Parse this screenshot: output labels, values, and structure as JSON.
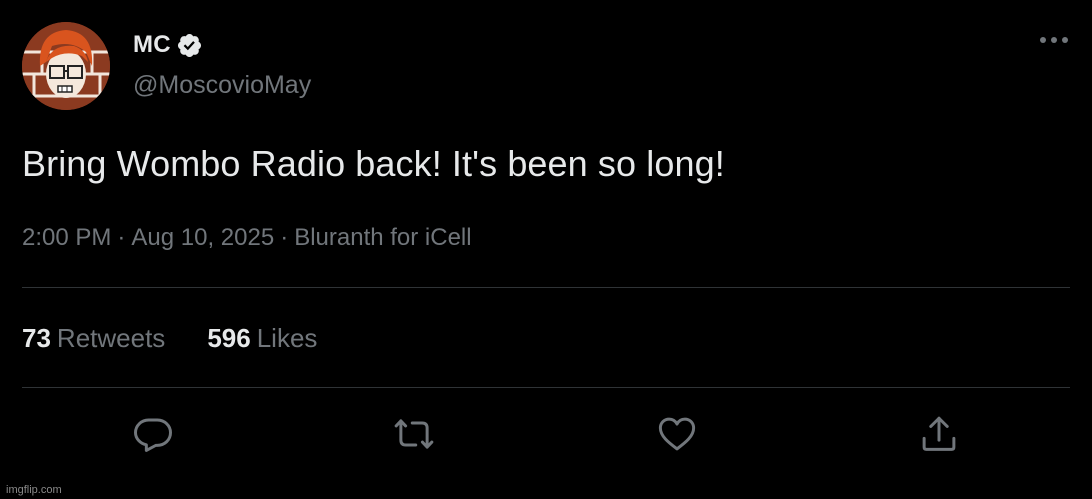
{
  "tweet": {
    "display_name": "MC",
    "handle": "@MoscovioMay",
    "text": "Bring Wombo Radio back! It's been so long!",
    "meta": {
      "time": "2:00 PM",
      "date": "Aug 10, 2025",
      "source": "Bluranth for iCell",
      "separator": "·"
    },
    "stats": {
      "retweets_count": "73",
      "retweets_label": "Retweets",
      "likes_count": "596",
      "likes_label": "Likes"
    },
    "icons": {
      "verified": "verified-badge-icon",
      "more": "more-options-icon",
      "reply": "reply-icon",
      "retweet": "retweet-icon",
      "like": "heart-icon",
      "share": "share-icon"
    }
  },
  "watermark": "imgflip.com",
  "colors": {
    "background": "#000000",
    "primary_text": "#e7e9ea",
    "secondary_text": "#71767b",
    "divider": "#2f3336"
  }
}
